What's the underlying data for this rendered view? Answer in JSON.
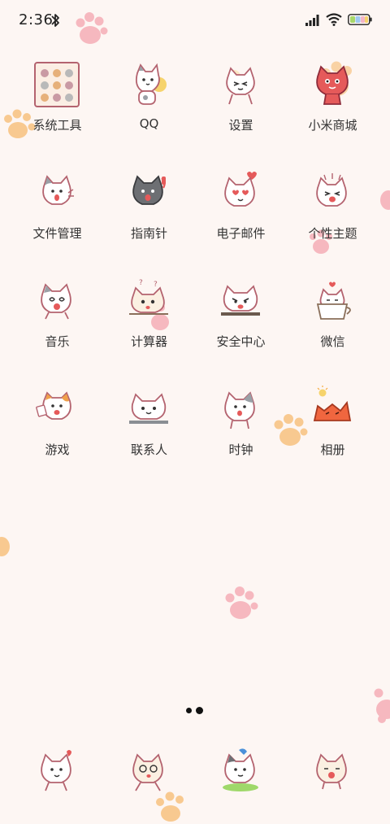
{
  "status_bar": {
    "time": "2:36",
    "icons": [
      "bluetooth-icon",
      "signal-icon",
      "wifi-icon",
      "battery-icon"
    ]
  },
  "colors": {
    "background": "#fdf6f3",
    "paw_pink": "#f6b8bf",
    "paw_orange": "#f8c990",
    "cat_line": "#c0607a",
    "accent_red": "#e55a5a"
  },
  "apps": [
    {
      "label": "系统工具",
      "icon": "tools-folder-icon"
    },
    {
      "label": "QQ",
      "icon": "cat-qq-icon"
    },
    {
      "label": "设置",
      "icon": "cat-settings-icon"
    },
    {
      "label": "小米商城",
      "icon": "cat-store-icon"
    },
    {
      "label": "文件管理",
      "icon": "cat-files-icon"
    },
    {
      "label": "指南针",
      "icon": "cat-compass-icon"
    },
    {
      "label": "电子邮件",
      "icon": "cat-email-icon"
    },
    {
      "label": "个性主题",
      "icon": "cat-themes-icon"
    },
    {
      "label": "音乐",
      "icon": "cat-music-icon"
    },
    {
      "label": "计算器",
      "icon": "cat-calculator-icon"
    },
    {
      "label": "安全中心",
      "icon": "cat-security-icon"
    },
    {
      "label": "微信",
      "icon": "cat-wechat-icon"
    },
    {
      "label": "游戏",
      "icon": "cat-games-icon"
    },
    {
      "label": "联系人",
      "icon": "cat-contacts-icon"
    },
    {
      "label": "时钟",
      "icon": "cat-clock-icon"
    },
    {
      "label": "相册",
      "icon": "cat-gallery-icon"
    }
  ],
  "page_indicator": {
    "pages": 2,
    "current": 1
  },
  "dock": [
    {
      "icon": "cat-phone-icon"
    },
    {
      "icon": "cat-messages-icon"
    },
    {
      "icon": "cat-browser-icon"
    },
    {
      "icon": "cat-camera-icon"
    }
  ]
}
